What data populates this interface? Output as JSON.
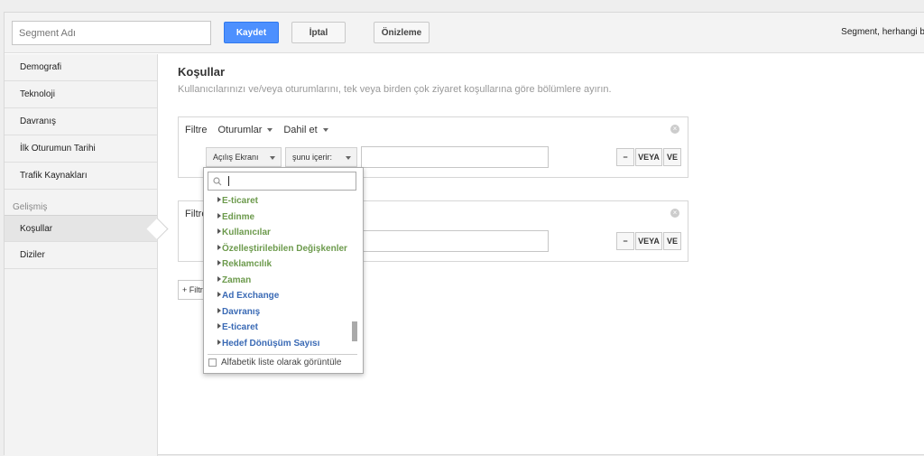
{
  "topbar": {
    "segment_placeholder": "Segment Adı",
    "save_label": "Kaydet",
    "cancel_label": "İptal",
    "preview_label": "Önizleme",
    "note": "Segment, herhangi b"
  },
  "sidebar": {
    "items": [
      {
        "label": "Demografi"
      },
      {
        "label": "Teknoloji"
      },
      {
        "label": "Davranış"
      },
      {
        "label": "İlk Oturumun Tarihi"
      },
      {
        "label": "Trafik Kaynakları"
      }
    ],
    "group_label": "Gelişmiş",
    "advanced": [
      {
        "label": "Koşullar",
        "active": true
      },
      {
        "label": "Diziler"
      }
    ]
  },
  "main": {
    "title": "Koşullar",
    "subtitle": "Kullanıcılarınızı ve/veya oturumlarını, tek veya birden çok ziyaret koşullarına göre bölümlere ayırın."
  },
  "filter1": {
    "label": "Filtre",
    "scope": "Oturumlar",
    "mode": "Dahil et",
    "dimension": "Açılış Ekranı",
    "operator": "şunu içerir:",
    "value": "",
    "minus": "−",
    "or": "VEYA",
    "and": "VE"
  },
  "filter2": {
    "label": "Filtre",
    "minus": "−",
    "or": "VEYA",
    "and": "VE"
  },
  "add_filter_label": "+ Filtre ekle",
  "popup": {
    "search_value": "",
    "items": [
      {
        "label": "E-ticaret",
        "color": "green"
      },
      {
        "label": "Edinme",
        "color": "green"
      },
      {
        "label": "Kullanıcılar",
        "color": "green"
      },
      {
        "label": "Özelleştirilebilen Değişkenler",
        "color": "green"
      },
      {
        "label": "Reklamcılık",
        "color": "green"
      },
      {
        "label": "Zaman",
        "color": "green"
      },
      {
        "label": "Ad Exchange",
        "color": "blue"
      },
      {
        "label": "Davranış",
        "color": "blue"
      },
      {
        "label": "E-ticaret",
        "color": "blue"
      },
      {
        "label": "Hedef Dönüşüm Sayısı",
        "color": "blue"
      }
    ],
    "alphabetic_label": "Alfabetik liste olarak görüntüle"
  },
  "colors": {
    "primary_button": "#4d90fe",
    "dimension_green": "#6c9a4c",
    "metric_blue": "#3a6ab5"
  }
}
